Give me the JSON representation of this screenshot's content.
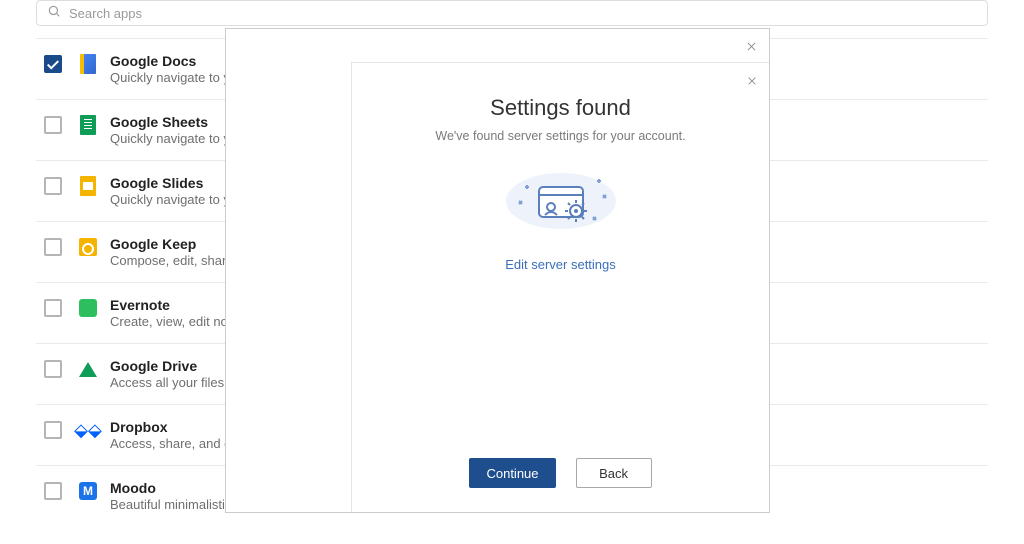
{
  "search": {
    "placeholder": "Search apps"
  },
  "apps": [
    {
      "title": "Google Docs",
      "desc": "Quickly navigate to your documents",
      "checked": true,
      "icon": "docs"
    },
    {
      "title": "Google Sheets",
      "desc": "Quickly navigate to your spreadsheets",
      "checked": false,
      "icon": "sheets"
    },
    {
      "title": "Google Slides",
      "desc": "Quickly navigate to your presentations",
      "checked": false,
      "icon": "slides"
    },
    {
      "title": "Google Keep",
      "desc": "Compose, edit, share, and collaborate on notes",
      "checked": false,
      "icon": "keep"
    },
    {
      "title": "Evernote",
      "desc": "Create, view, edit notes and notebooks",
      "checked": false,
      "icon": "evernote"
    },
    {
      "title": "Google Drive",
      "desc": "Access all your files in one place",
      "checked": false,
      "icon": "drive"
    },
    {
      "title": "Dropbox",
      "desc": "Access, share, and organize your files",
      "checked": false,
      "icon": "dropbox"
    },
    {
      "title": "Moodo",
      "desc": "Beautiful minimalistic to-do lists",
      "checked": false,
      "icon": "moodo"
    }
  ],
  "modal": {
    "title": "Settings found",
    "subtitle": "We've found server settings for your account.",
    "edit_link": "Edit server settings",
    "continue_label": "Continue",
    "back_label": "Back"
  }
}
